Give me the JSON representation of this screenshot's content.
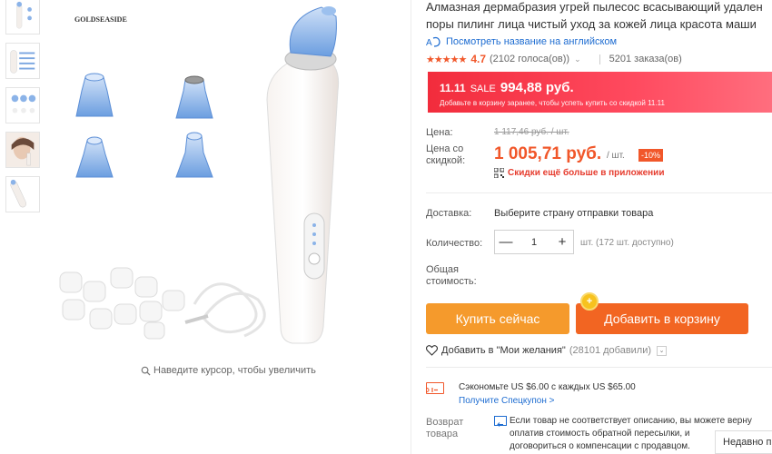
{
  "gallery": {
    "brand": "GOLDSEASIDE",
    "zoom_hint": "Наведите курсор, чтобы увеличить"
  },
  "product": {
    "title_line1": "Алмазная дермабразия угрей пылесос всасывающий удален",
    "title_line2": "поры пилинг лица чистый уход за кожей лица красота маши",
    "translate_link": "Посмотреть название на английском",
    "stars": "★★★★★",
    "rating": "4.7",
    "votes": "(2102 голоса(ов))",
    "orders": "5201 заказа(ов)"
  },
  "sale": {
    "date": "11.11",
    "label": "SALE",
    "price": "994,88 руб.",
    "note": "Добавьте в корзину заранее, чтобы успеть купить со скидкой 11.11"
  },
  "pricing": {
    "price_label": "Цена:",
    "orig_price": "1 117,46 руб. / шт.",
    "disc_label": "Цена со скидкой:",
    "disc_price": "1 005,71 руб.",
    "per_unit": "/ шт.",
    "discount": "-10%",
    "app_promo": "Скидки ещё больше в приложении"
  },
  "shipping": {
    "label": "Доставка:",
    "value": "Выберите страну отправки товара"
  },
  "quantity": {
    "label": "Количество:",
    "value": "1",
    "minus": "—",
    "plus": "+",
    "available": "шт. (172 шт. доступно)"
  },
  "total": {
    "label": "Общая стоимость:"
  },
  "buttons": {
    "buy": "Купить сейчас",
    "cart": "Добавить в корзину"
  },
  "wishlist": {
    "text": "Добавить в \"Мои желания\"",
    "count": "(28101 добавили)"
  },
  "coupon": {
    "text": "Сэкономьте US $6.00 с каждых US $65.00",
    "link": "Получите Спецкупон >"
  },
  "returns": {
    "label": "Возврат товара",
    "line1": "Если товар не соответствует описанию, вы можете верну",
    "line2": "оплатив стоимость обратной пересылки, и",
    "line3": "договориться о компенсации с продавцом."
  },
  "recent": {
    "label": "Недавно п"
  },
  "colors": {
    "accent": "#f1572a",
    "buy": "#f59a2c",
    "cart": "#f26522",
    "link": "#1d6cd1"
  }
}
